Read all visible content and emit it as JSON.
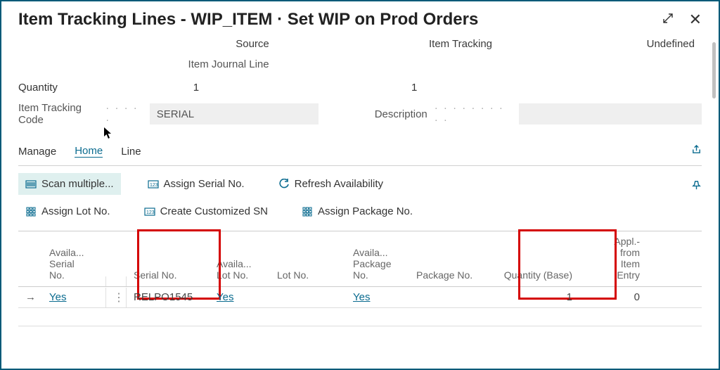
{
  "header": {
    "title": "Item Tracking Lines - WIP_ITEM · Set WIP on Prod Orders"
  },
  "summary": {
    "source_label": "Source",
    "tracking_label": "Item Tracking",
    "undefined_label": "Undefined",
    "journal_line": "Item Journal Line",
    "quantity_label": "Quantity",
    "source_qty": "1",
    "tracking_qty": "1",
    "undefined_qty": ""
  },
  "fields": {
    "tracking_code_label": "Item Tracking Code",
    "tracking_code_value": "SERIAL",
    "description_label": "Description",
    "description_value": ""
  },
  "tabs": {
    "manage": "Manage",
    "home": "Home",
    "line": "Line"
  },
  "ribbon": {
    "scan_multiple": "Scan multiple...",
    "assign_serial": "Assign Serial No.",
    "refresh": "Refresh Availability",
    "assign_lot": "Assign Lot No.",
    "create_custom_sn": "Create Customized SN",
    "assign_package": "Assign Package No."
  },
  "grid": {
    "headers": {
      "avail_serial": "Availa...\nSerial\nNo.",
      "serial_no": "Serial No.",
      "avail_lot": "Availa...\nLot No.",
      "lot_no": "Lot No.",
      "avail_pkg": "Availa...\nPackage\nNo.",
      "package_no": "Package No.",
      "qty_base": "Quantity (Base)",
      "appl_from": "Appl.-from\nItem Entry"
    },
    "rows": [
      {
        "avail_serial": "Yes",
        "serial_no": "RELPO1545",
        "avail_lot": "Yes",
        "lot_no": "",
        "avail_pkg": "Yes",
        "package_no": "",
        "qty_base": "1",
        "appl_from": "0"
      }
    ]
  }
}
